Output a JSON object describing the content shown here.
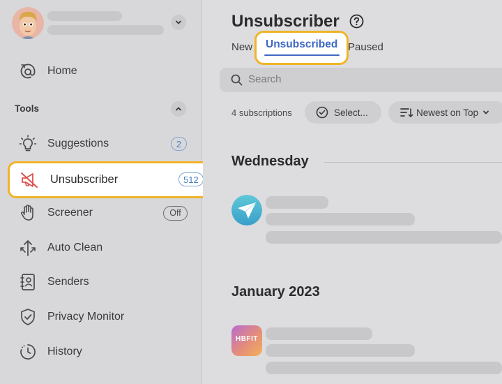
{
  "sidebar": {
    "nav_home": "Home",
    "section_title": "Tools",
    "items": [
      {
        "label": "Suggestions",
        "badge": "2",
        "icon": "lightbulb-icon"
      },
      {
        "label": "Unsubscriber",
        "badge": "512",
        "icon": "muted-megaphone-icon"
      },
      {
        "label": "Screener",
        "badge": "Off",
        "icon": "hand-icon"
      },
      {
        "label": "Auto Clean",
        "icon": "auto-clean-arrows-icon"
      },
      {
        "label": "Senders",
        "icon": "contact-book-icon"
      },
      {
        "label": "Privacy Monitor",
        "icon": "shield-check-icon"
      },
      {
        "label": "History",
        "icon": "history-clock-icon"
      }
    ]
  },
  "main": {
    "title": "Unsubscriber",
    "tabs": [
      {
        "label": "New"
      },
      {
        "label": "Unsubscribed",
        "active": true
      },
      {
        "label": "Paused"
      }
    ],
    "search": {
      "placeholder": "Search"
    },
    "subscriptions_count": "4 subscriptions",
    "select_label": "Select...",
    "sort_label": "Newest on Top",
    "groups": [
      {
        "title": "Wednesday",
        "app_icon": "paper-plane-app-icon"
      },
      {
        "title": "January 2023",
        "app_icon": "hbfit-app-icon",
        "app_icon_text": "HBFIT"
      }
    ]
  },
  "colors": {
    "highlight": "#f0b429",
    "accent_blue": "#3f68c4",
    "unsubscribe_red": "#d9534f"
  }
}
